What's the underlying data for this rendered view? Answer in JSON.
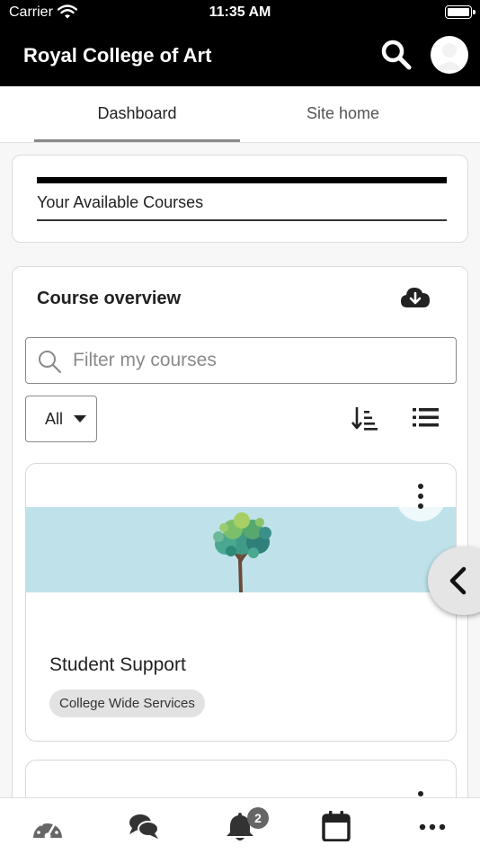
{
  "status_bar": {
    "carrier": "Carrier",
    "time": "11:35 AM"
  },
  "app_bar": {
    "title": "Royal College of Art"
  },
  "tabs": [
    {
      "label": "Dashboard",
      "selected": true
    },
    {
      "label": "Site home",
      "selected": false
    }
  ],
  "available_courses": {
    "heading": "Your Available Courses"
  },
  "course_overview": {
    "title": "Course overview",
    "filter": {
      "placeholder": "Filter my courses",
      "value": ""
    },
    "status_filter": {
      "selected": "All"
    },
    "courses": [
      {
        "name": "Student Support",
        "category": "College Wide Services",
        "image_color": "#bfe2ea"
      }
    ]
  },
  "bottom_nav": {
    "items": [
      "dashboard-icon",
      "messages-icon",
      "notifications-icon",
      "calendar-icon",
      "more-icon"
    ],
    "notification_count": "2"
  },
  "colors": {
    "app_bar": "#000000",
    "background": "#f7f7f7",
    "course_image": "#bfe2ea",
    "badge": "#666666"
  }
}
